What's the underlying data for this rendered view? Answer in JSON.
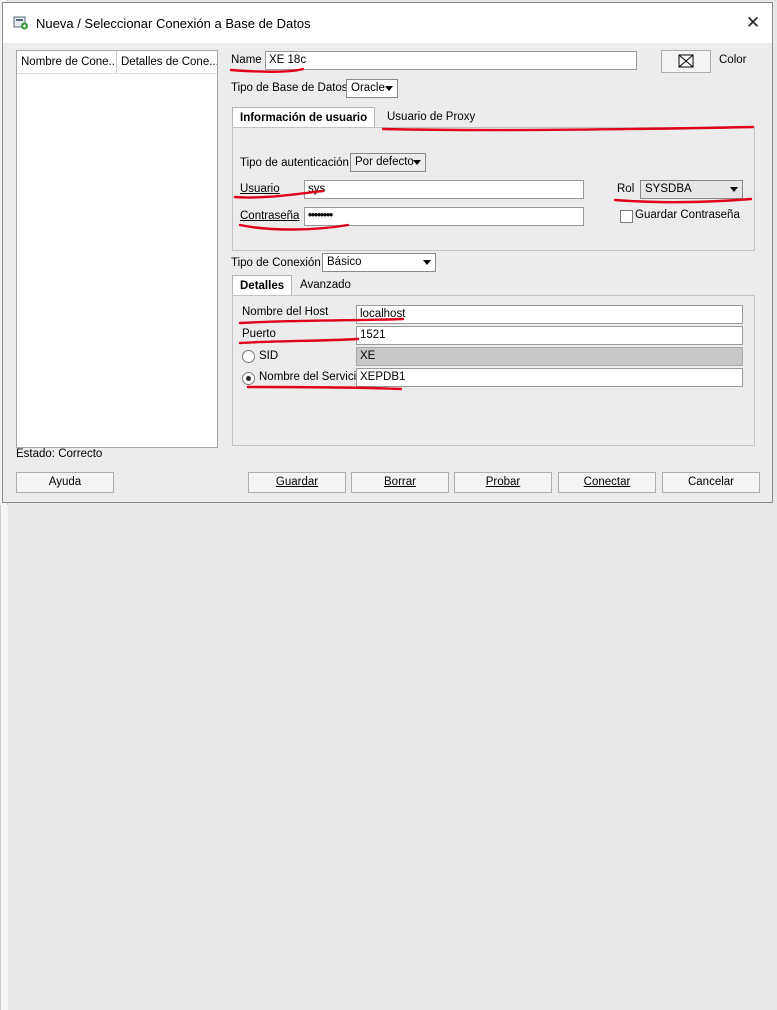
{
  "window": {
    "title": "Nueva / Seleccionar Conexión a Base de Datos",
    "close_glyph": "✕"
  },
  "list": {
    "columns": [
      "Nombre de Cone...",
      "Detalles de Cone..."
    ]
  },
  "form": {
    "name_label": "Name",
    "name_value": "XE 18c",
    "color_label": "Color",
    "db_type_label": "Tipo de Base de Datos",
    "db_type_value": "Oracle"
  },
  "user_tabs": {
    "active": "Información de usuario",
    "other": "Usuario de Proxy"
  },
  "auth": {
    "type_label": "Tipo de autenticación",
    "type_value": "Por defecto",
    "user_label": "Usuario",
    "user_value": "sys",
    "password_label": "Contraseña",
    "password_value": "••••••••",
    "role_label": "Rol",
    "role_value": "SYSDBA",
    "save_password_label": "Guardar Contraseña",
    "save_password_checked": false
  },
  "connection": {
    "type_label": "Tipo de Conexión",
    "type_value": "Básico"
  },
  "detail_tabs": {
    "active": "Detalles",
    "other": "Avanzado"
  },
  "details": {
    "host_label": "Nombre del Host",
    "host_value": "localhost",
    "port_label": "Puerto",
    "port_value": "1521",
    "sid_label": "SID",
    "sid_value": "XE",
    "service_label": "Nombre del Servicio",
    "service_value": "XEPDB1",
    "selected": "service"
  },
  "status": "Estado: Correcto",
  "buttons": {
    "help": "Ayuda",
    "save": "Guardar",
    "clear": "Borrar",
    "test": "Probar",
    "connect": "Conectar",
    "cancel": "Cancelar"
  },
  "annotation_color": "#e0001b"
}
